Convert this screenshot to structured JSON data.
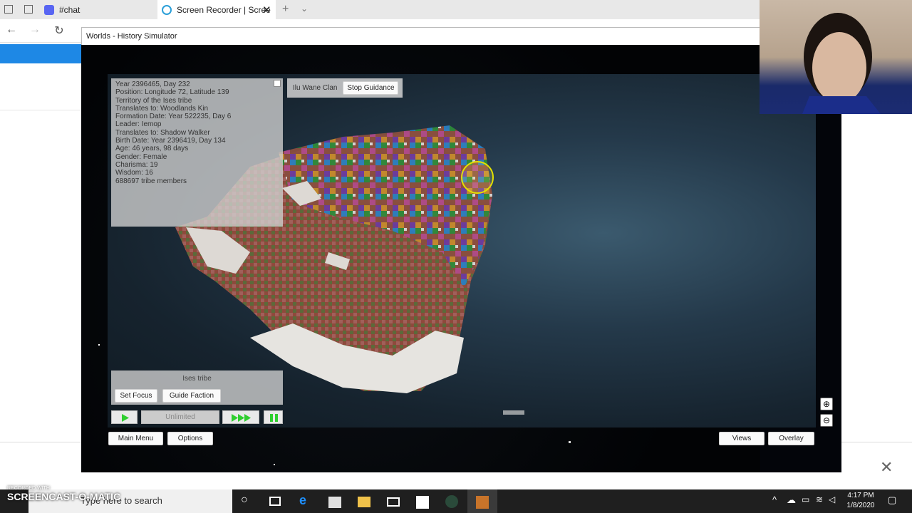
{
  "browser": {
    "tabs": [
      {
        "label": "#chat",
        "icon": "discord-icon"
      },
      {
        "label": "Screen Recorder | Scree",
        "icon": "screencast-icon"
      }
    ]
  },
  "window": {
    "title": "Worlds - History Simulator"
  },
  "info_panel": {
    "lines": [
      "Year 2396465, Day 232",
      "",
      "Position: Longitude 72, Latitude 139",
      "",
      "Territory of the Ises tribe",
      "Translates to: Woodlands Kin",
      "Formation Date: Year 522235, Day 6",
      "",
      "Leader: Iemop",
      "Translates to: Shadow Walker",
      "Birth Date: Year 2396419, Day 134",
      "Age: 46 years, 98 days",
      "Gender: Female",
      "Charisma: 19",
      "Wisdom: 16",
      "",
      "688697 tribe members"
    ]
  },
  "guidance": {
    "clan_label": "Ilu Wane Clan",
    "stop_label": "Stop Guidance"
  },
  "tribe_panel": {
    "name": "Ises tribe",
    "set_focus": "Set Focus",
    "guide_faction": "Guide Faction"
  },
  "speed": {
    "label": "Unlimited"
  },
  "bottom_buttons": {
    "main_menu": "Main Menu",
    "options": "Options",
    "views": "Views",
    "overlay": "Overlay"
  },
  "taskbar": {
    "search_placeholder": "Type here to search",
    "time": "4:17 PM",
    "date": "1/8/2020"
  },
  "watermark": {
    "line1": "RECORDED WITH",
    "line2": "SCREENCAST-O-MATIC"
  },
  "colors": {
    "accent": "#1e88e5",
    "taskbar": "#1f1f1f",
    "cursor_highlight": "#e3e000"
  }
}
